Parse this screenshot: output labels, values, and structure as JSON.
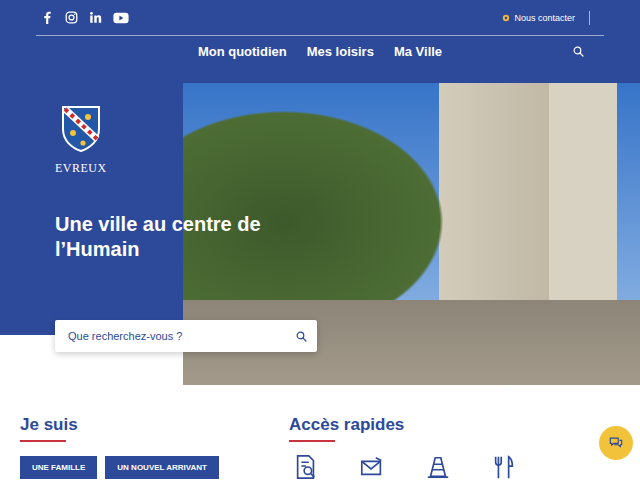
{
  "top_bar": {
    "contact": "Nous contacter"
  },
  "nav": [
    {
      "label": "Mon quotidien"
    },
    {
      "label": "Mes loisirs"
    },
    {
      "label": "Ma Ville"
    }
  ],
  "logo": {
    "name": "EVREUX"
  },
  "hero": {
    "title": "Une ville au centre de l’Humain"
  },
  "search": {
    "placeholder": "Que recherchez-vous ?"
  },
  "profile": {
    "title": "Je suis",
    "buttons": [
      "UNE FAMILLE",
      "UN NOUVEL ARRIVANT"
    ]
  },
  "quick_access": {
    "title": "Accès rapides"
  }
}
